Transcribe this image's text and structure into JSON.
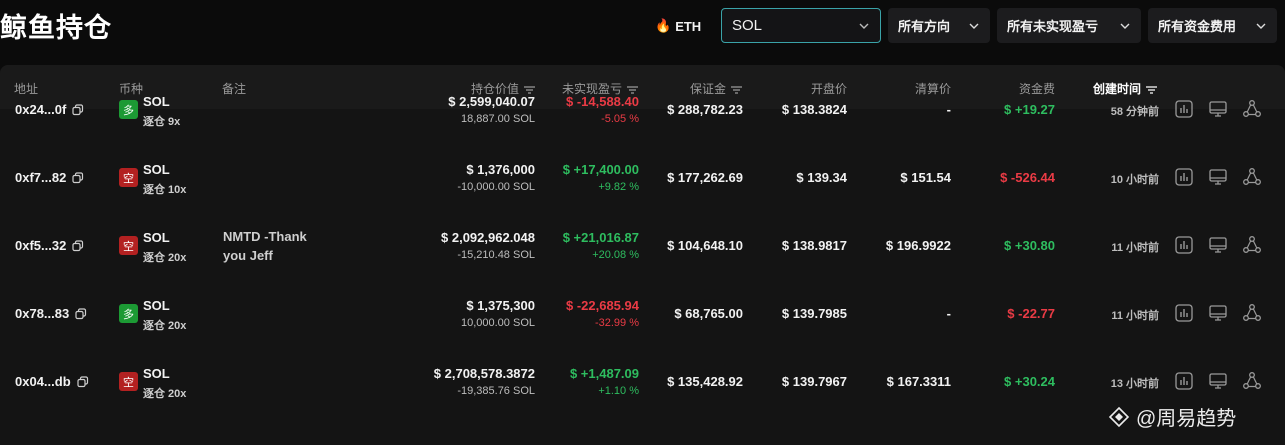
{
  "header": {
    "title": "鲸鱼持仓",
    "eth_chip": "ETH",
    "coin_select": "SOL",
    "direction_select": "所有方向",
    "pnl_select": "所有未实现盈亏",
    "fee_select": "所有资金费用"
  },
  "columns": {
    "address": "地址",
    "coin": "币种",
    "note": "备注",
    "position_value": "持仓价值",
    "unrealized_pnl": "未实现盈亏",
    "margin": "保证金",
    "open_price": "开盘价",
    "liq_price": "清算价",
    "funding": "资金费",
    "created": "创建时间"
  },
  "rows": [
    {
      "address": "0x24...0f",
      "side": "多",
      "side_type": "long",
      "symbol": "SOL",
      "leverage": "逐仓 9x",
      "note": "",
      "value": "$ 2,599,040.07",
      "size": "18,887.00 SOL",
      "pnl": "$ -14,588.40",
      "pnl_pct": "-5.05 %",
      "pnl_sign": "neg",
      "margin": "$ 288,782.23",
      "open": "$ 138.3824",
      "liq": "-",
      "funding": "$ +19.27",
      "funding_sign": "pos",
      "time": "58 分钟前"
    },
    {
      "address": "0xf7...82",
      "side": "空",
      "side_type": "short",
      "symbol": "SOL",
      "leverage": "逐仓 10x",
      "note": "",
      "value": "$ 1,376,000",
      "size": "-10,000.00 SOL",
      "pnl": "$ +17,400.00",
      "pnl_pct": "+9.82 %",
      "pnl_sign": "pos",
      "margin": "$ 177,262.69",
      "open": "$ 139.34",
      "liq": "$ 151.54",
      "funding": "$ -526.44",
      "funding_sign": "neg",
      "time": "10 小时前"
    },
    {
      "address": "0xf5...32",
      "side": "空",
      "side_type": "short",
      "symbol": "SOL",
      "leverage": "逐仓 20x",
      "note": "NMTD -Thank you Jeff",
      "value": "$ 2,092,962.048",
      "size": "-15,210.48 SOL",
      "pnl": "$ +21,016.87",
      "pnl_pct": "+20.08 %",
      "pnl_sign": "pos",
      "margin": "$ 104,648.10",
      "open": "$ 138.9817",
      "liq": "$ 196.9922",
      "funding": "$ +30.80",
      "funding_sign": "pos",
      "time": "11 小时前"
    },
    {
      "address": "0x78...83",
      "side": "多",
      "side_type": "long",
      "symbol": "SOL",
      "leverage": "逐仓 20x",
      "note": "",
      "value": "$ 1,375,300",
      "size": "10,000.00 SOL",
      "pnl": "$ -22,685.94",
      "pnl_pct": "-32.99 %",
      "pnl_sign": "neg",
      "margin": "$ 68,765.00",
      "open": "$ 139.7985",
      "liq": "-",
      "funding": "$ -22.77",
      "funding_sign": "neg",
      "time": "11 小时前"
    },
    {
      "address": "0x04...db",
      "side": "空",
      "side_type": "short",
      "symbol": "SOL",
      "leverage": "逐仓 20x",
      "note": "",
      "value": "$ 2,708,578.3872",
      "size": "-19,385.76 SOL",
      "pnl": "$ +1,487.09",
      "pnl_pct": "+1.10 %",
      "pnl_sign": "pos",
      "margin": "$ 135,428.92",
      "open": "$ 139.7967",
      "liq": "$ 167.3311",
      "funding": "$ +30.24",
      "funding_sign": "pos",
      "time": "13 小时前"
    }
  ],
  "watermark": "@周易趋势",
  "colors": {
    "accent_border": "#3aa3a8",
    "positive": "#2ebd5f",
    "negative": "#ea3b45",
    "long_badge": "#1c9a34",
    "short_badge": "#b32121"
  }
}
